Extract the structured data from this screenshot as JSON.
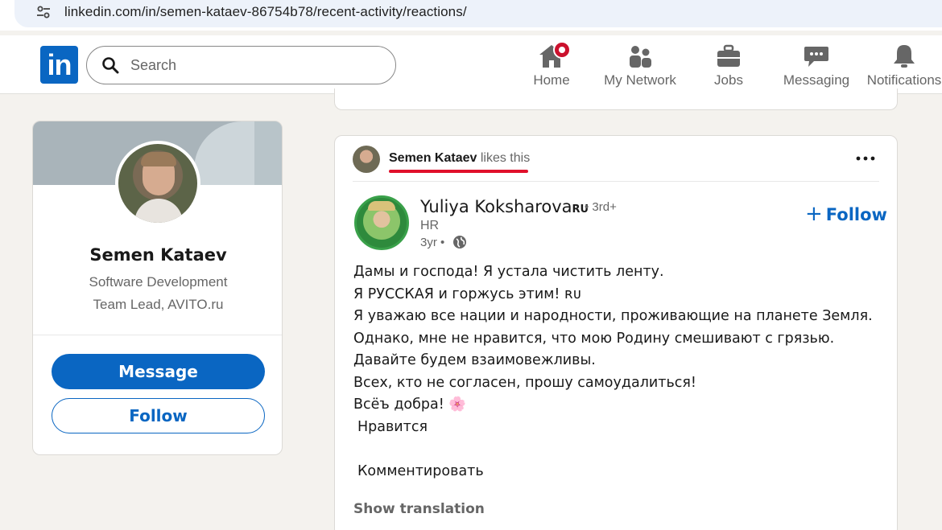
{
  "browser": {
    "url_host": "linkedin.com",
    "url_path": "/in/semen-kataev-86754b78/recent-activity/reactions/",
    "site_info_icon": "tune-icon"
  },
  "header": {
    "logo_text": "in",
    "search_placeholder": "Search",
    "nav": [
      {
        "label": "Home",
        "icon": "home-icon",
        "has_badge": true
      },
      {
        "label": "My Network",
        "icon": "network-icon"
      },
      {
        "label": "Jobs",
        "icon": "briefcase-icon"
      },
      {
        "label": "Messaging",
        "icon": "messaging-icon"
      },
      {
        "label": "Notifications",
        "icon": "bell-icon"
      }
    ]
  },
  "profile": {
    "name": "Semen Kataev",
    "headline_line1": "Software Development",
    "headline_line2": "Team Lead, AVITO.ru",
    "message_label": "Message",
    "follow_label": "Follow"
  },
  "post": {
    "actor_name": "Semen Kataev",
    "actor_action": "likes this",
    "author_name": "Yuliya Koksharova",
    "author_flag": "RU",
    "author_degree": "• 3rd+",
    "author_title": "HR",
    "author_time": "3yr •",
    "follow_label": "Follow",
    "body_lines": [
      "Дамы и господа! Я устала чистить ленту.",
      "Я РУССКАЯ и горжусь этим! ʀᴜ",
      "Я уважаю все нации и народности, проживающие на планете Земля.",
      "Однако, мне не нравится, что мою Родину смешивают с грязью.",
      "Давайте будем взаимовежливы.",
      "Всех, кто не согласен, прошу самоудалиться!",
      "Всёъ добра! 🌸"
    ],
    "like_text": "Нравится",
    "comment_text": "Комментировать",
    "show_translation": "Show translation"
  },
  "colors": {
    "brand": "#0a66c2",
    "badge": "#cb112d",
    "underline": "#e0102b"
  }
}
